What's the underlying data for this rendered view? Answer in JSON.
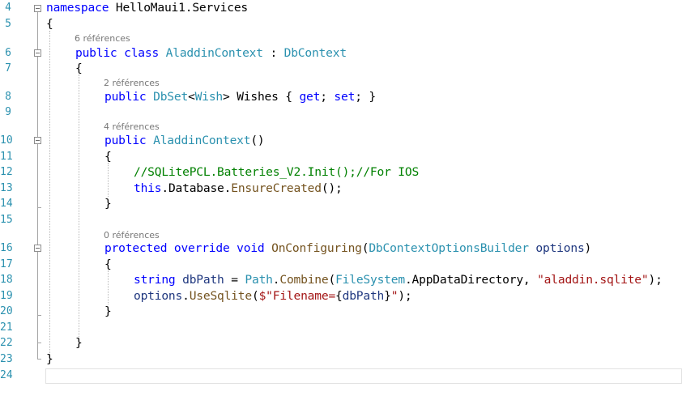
{
  "editor": {
    "line_numbers": [
      "4",
      "5",
      "6",
      "7",
      "8",
      "9",
      "10",
      "11",
      "12",
      "13",
      "14",
      "15",
      "16",
      "17",
      "18",
      "19",
      "20",
      "21",
      "22",
      "23",
      "24"
    ],
    "codelens": {
      "class_refs": "6 références",
      "wishes_refs": "2 références",
      "ctor_refs": "4 références",
      "onconfig_refs": "0 références"
    },
    "code": {
      "l4_namespace": "namespace",
      "l4_name": " HelloMaui1.Services",
      "open_brace": "{",
      "close_brace": "}",
      "l6_public": "public",
      "l6_class": " class ",
      "l6_type": "AladdinContext",
      "l6_colon": " : ",
      "l6_base": "DbContext",
      "l8_public": "public",
      "l8_dbset": "DbSet",
      "l8_lt": "<",
      "l8_wish": "Wish",
      "l8_gt": "> Wishes { ",
      "l8_get": "get",
      "l8_semi1": "; ",
      "l8_set": "set",
      "l8_semi2": "; }",
      "l10_public": "public",
      "l10_ctor": "AladdinContext",
      "l10_parens": "()",
      "l12_comment": "//SQLitePCL.Batteries_V2.Init();//For IOS",
      "l13_this": "this",
      "l13_db": ".Database.",
      "l13_method": "EnsureCreated",
      "l13_end": "();",
      "l16_protected": "protected",
      "l16_override": "override",
      "l16_void": "void",
      "l16_method": "OnConfiguring",
      "l16_open": "(",
      "l16_type": "DbContextOptionsBuilder",
      "l16_param": "options",
      "l16_close": ")",
      "l18_string": "string",
      "l18_var": "dbPath",
      "l18_eq": " = ",
      "l18_path": "Path",
      "l18_dot1": ".",
      "l18_combine": "Combine",
      "l18_open": "(",
      "l18_fs": "FileSystem",
      "l18_dir": ".AppDataDirectory, ",
      "l18_str": "\"aladdin.sqlite\"",
      "l18_end": ");",
      "l19_options": "options",
      "l19_dot": ".",
      "l19_method": "UseSqlite",
      "l19_open": "(",
      "l19_str1": "$\"Filename=",
      "l19_interp_open": "{",
      "l19_var": "dbPath",
      "l19_interp_close": "}",
      "l19_str2": "\"",
      "l19_end": ");"
    }
  }
}
